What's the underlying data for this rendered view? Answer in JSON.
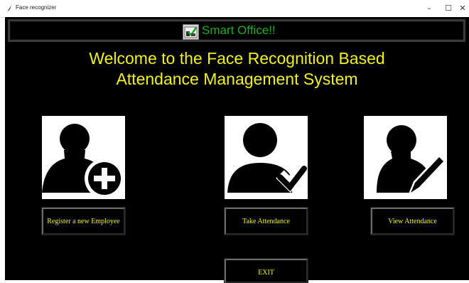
{
  "window": {
    "title": "Face recognizer",
    "controls": {
      "minimize": "–",
      "maximize": "☐",
      "close": "✕"
    }
  },
  "banner": {
    "title": "Smart Office!!",
    "icon": "office-checklist-icon"
  },
  "headline": {
    "line1": "Welcome to the Face Recognition Based",
    "line2": "Attendance Management System"
  },
  "cards": [
    {
      "name": "register",
      "icon": "user-add-icon"
    },
    {
      "name": "take",
      "icon": "user-check-icon"
    },
    {
      "name": "view",
      "icon": "user-edit-icon"
    }
  ],
  "buttons": {
    "register": "Register a new Employee",
    "take": "Take Attendance",
    "view": "View Attendance",
    "exit": "EXIT"
  },
  "colors": {
    "background": "#000000",
    "headline": "#f2f21e",
    "banner_text": "#17b01a",
    "button_text": "#f2f21e"
  }
}
